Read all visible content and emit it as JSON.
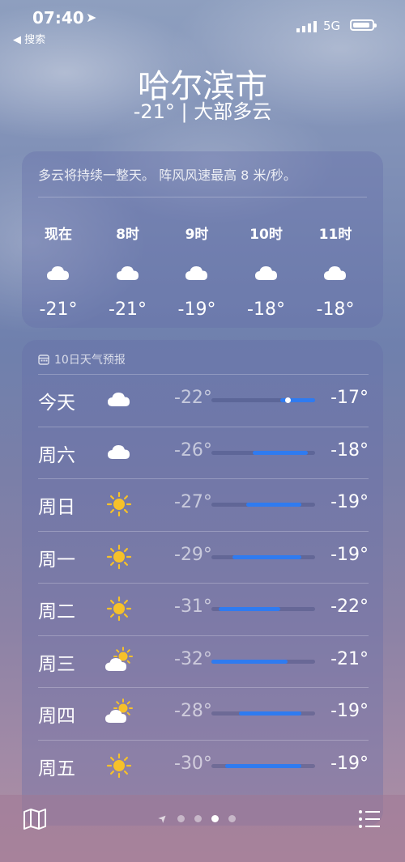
{
  "status": {
    "time": "07:40",
    "back_label": "◀ 搜索",
    "network": "5G"
  },
  "header": {
    "city": "哈尔滨市",
    "subtitle": "-21° | 大部多云"
  },
  "hourly": {
    "summary": "多云将持续一整天。 阵风风速最高 8 米/秒。",
    "items": [
      {
        "label": "现在",
        "temp": "-21°",
        "icon": "cloud-icon"
      },
      {
        "label": "8时",
        "temp": "-21°",
        "icon": "cloud-icon"
      },
      {
        "label": "9时",
        "temp": "-19°",
        "icon": "cloud-icon"
      },
      {
        "label": "10时",
        "temp": "-18°",
        "icon": "cloud-icon"
      },
      {
        "label": "11时",
        "temp": "-18°",
        "icon": "cloud-icon"
      }
    ]
  },
  "daily": {
    "title": "10日天气预报",
    "range_min": -32,
    "range_max": -17,
    "current_temp": -21,
    "items": [
      {
        "day": "今天",
        "icon": "cloud-icon",
        "low": "-22°",
        "high": "-17°",
        "low_v": -22,
        "high_v": -17
      },
      {
        "day": "周六",
        "icon": "cloud-icon",
        "low": "-26°",
        "high": "-18°",
        "low_v": -26,
        "high_v": -18
      },
      {
        "day": "周日",
        "icon": "sun-icon",
        "low": "-27°",
        "high": "-19°",
        "low_v": -27,
        "high_v": -19
      },
      {
        "day": "周一",
        "icon": "sun-icon",
        "low": "-29°",
        "high": "-19°",
        "low_v": -29,
        "high_v": -19
      },
      {
        "day": "周二",
        "icon": "sun-icon",
        "low": "-31°",
        "high": "-22°",
        "low_v": -31,
        "high_v": -22
      },
      {
        "day": "周三",
        "icon": "partly-sunny-icon",
        "low": "-32°",
        "high": "-21°",
        "low_v": -32,
        "high_v": -21
      },
      {
        "day": "周四",
        "icon": "partly-sunny-icon",
        "low": "-28°",
        "high": "-19°",
        "low_v": -28,
        "high_v": -19
      },
      {
        "day": "周五",
        "icon": "sun-icon",
        "low": "-30°",
        "high": "-19°",
        "low_v": -30,
        "high_v": -19
      }
    ]
  },
  "pager": {
    "count": 4,
    "active": 2
  },
  "colors": {
    "bar": "#2f7bf0",
    "sun": "#f6c12a"
  }
}
